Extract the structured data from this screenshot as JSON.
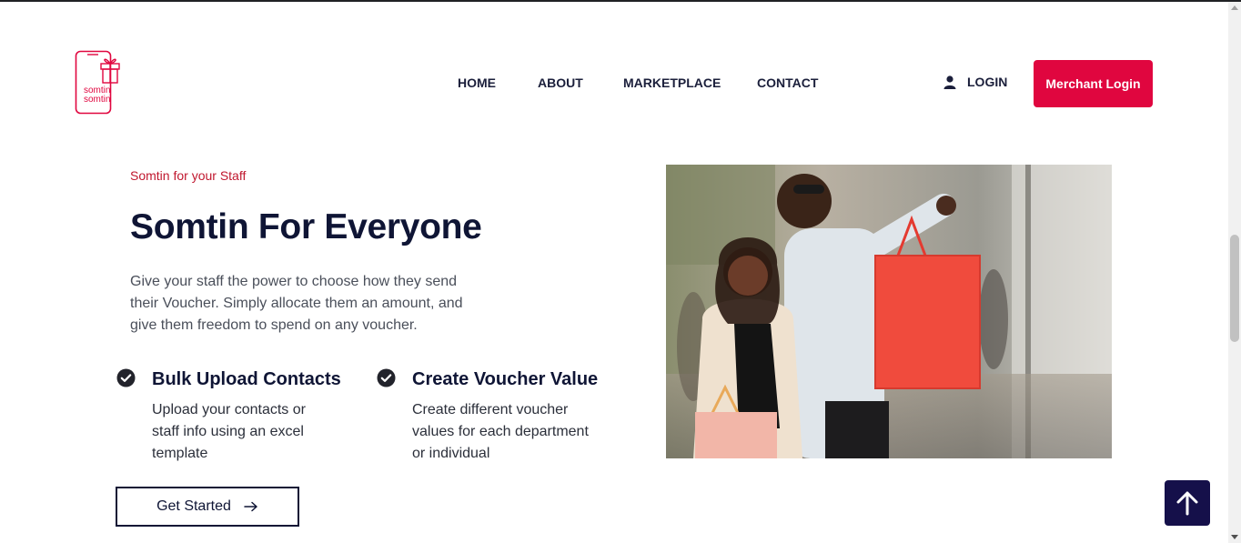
{
  "brand": {
    "logo_text_line1": "somtin",
    "logo_text_line2": "somtin",
    "logo_icon": "gift-phone-logo",
    "accent_color": "#e0063f"
  },
  "nav": {
    "items": [
      {
        "label": "HOME"
      },
      {
        "label": "ABOUT"
      },
      {
        "label": "MARKETPLACE"
      },
      {
        "label": "CONTACT"
      }
    ],
    "login_label": "LOGIN",
    "login_icon": "user-icon",
    "merchant_label": "Merchant Login"
  },
  "hero": {
    "eyebrow": "Somtin for your Staff",
    "title": "Somtin For Everyone",
    "description": "Give your staff the power to choose how they send their Voucher. Simply allocate them an amount, and give them freedom to spend on any voucher.",
    "features": [
      {
        "icon": "check-circle-icon",
        "title": "Bulk Upload Contacts",
        "description": "Upload your contacts or staff info using an excel template"
      },
      {
        "icon": "check-circle-icon",
        "title": "Create Voucher Value",
        "description": "Create different voucher values for each department or individual"
      }
    ],
    "cta_label": "Get Started",
    "cta_icon": "arrow-right-icon",
    "image_alt": "couple-shopping-photo"
  },
  "scroll_top_icon": "arrow-up-icon",
  "colors": {
    "navy": "#0f1535",
    "red": "#c0172e",
    "scroll_btn": "#15104a"
  }
}
